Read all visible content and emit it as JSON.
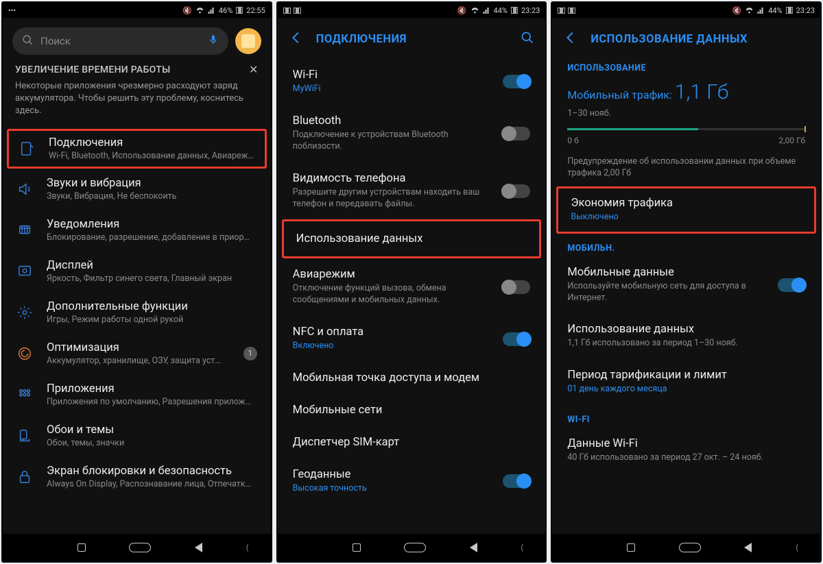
{
  "screen1": {
    "status": {
      "left_icons": "•••",
      "battery": "46%",
      "time": "22:55"
    },
    "search_placeholder": "Поиск",
    "banner": {
      "title": "УВЕЛИЧЕНИЕ ВРЕМЕНИ РАБОТЫ",
      "body": "Некоторые приложения чрезмерно расходуют заряд аккумулятора. Чтобы решить эту проблему, коснитесь здесь."
    },
    "items": [
      {
        "title": "Подключения",
        "sub": "Wi-Fi, Bluetooth, Использование данных, Авиареж…",
        "highlight": true
      },
      {
        "title": "Звуки и вибрация",
        "sub": "Звуки, Вибрация, Не беспокоить"
      },
      {
        "title": "Уведомления",
        "sub": "Блокирование, разрешение, добавление в приор…"
      },
      {
        "title": "Дисплей",
        "sub": "Яркость, Фильтр синего света, Главный экран"
      },
      {
        "title": "Дополнительные функции",
        "sub": "Игры, Режим работы одной рукой"
      },
      {
        "title": "Оптимизация",
        "sub": "Аккумулятор, хранилище, ОЗУ, защита уст…",
        "badge": "1"
      },
      {
        "title": "Приложения",
        "sub": "Приложения по умолчанию, Разрешения прилож…"
      },
      {
        "title": "Обои и темы",
        "sub": "Обои, темы, значки"
      },
      {
        "title": "Экран блокировки и безопасность",
        "sub": "Always On Display, Распознавание лица, Отпечатк…"
      }
    ]
  },
  "screen2": {
    "status": {
      "battery": "44%",
      "time": "23:23"
    },
    "title": "ПОДКЛЮЧЕНИЯ",
    "items": [
      {
        "title": "Wi-Fi",
        "sub": "MyWiFi",
        "blue": true,
        "toggle": "on"
      },
      {
        "title": "Bluetooth",
        "sub": "Подключение к устройствам Bluetooth поблизости.",
        "toggle": "off"
      },
      {
        "title": "Видимость телефона",
        "sub": "Разрешите другим устройствам находить ваш телефон и передавать файлы.",
        "toggle": "off"
      },
      {
        "title": "Использование данных",
        "highlight": true
      },
      {
        "title": "Авиарежим",
        "sub": "Отключение функций вызова, обмена сообщениями и мобильных данных.",
        "toggle": "off"
      },
      {
        "title": "NFC и оплата",
        "sub": "Включено",
        "blue": true,
        "toggle": "on"
      },
      {
        "title": "Мобильная точка доступа и модем"
      },
      {
        "title": "Мобильные сети"
      },
      {
        "title": "Диспетчер SIM-карт"
      },
      {
        "title": "Геоданные",
        "sub": "Высокая точность",
        "blue": true,
        "toggle": "on"
      }
    ]
  },
  "screen3": {
    "status": {
      "battery": "44%",
      "time": "23:23"
    },
    "title": "ИСПОЛЬЗОВАНИЕ ДАННЫХ",
    "section_usage": "ИСПОЛЬЗОВАНИЕ",
    "usage": {
      "label": "Мобильный трафик:",
      "value": "1,1 Гб",
      "period": "1–30 нояб.",
      "scale_left": "0 б",
      "scale_right": "2,00 Гб",
      "fill_pct": 55,
      "marker_pct": 100,
      "warning": "Предупреждение об использовании данных при объеме трафика 2,00 Гб"
    },
    "saver": {
      "title": "Экономия трафика",
      "sub": "Выключено"
    },
    "section_mobile": "МОБИЛЬН.",
    "mobile_items": [
      {
        "title": "Мобильные данные",
        "sub": "Используйте мобильную сеть для доступа в Интернет.",
        "toggle": "on"
      },
      {
        "title": "Использование данных",
        "sub": "1,1 Гб использовано за период 1–30 нояб."
      },
      {
        "title": "Период тарификации и лимит",
        "sub": "01 день каждого месяца",
        "blue": true
      }
    ],
    "section_wifi": "WI-FI",
    "wifi_items": [
      {
        "title": "Данные Wi-Fi",
        "sub": "40 Гб использовано за период 27 окт. – 24 нояб."
      }
    ]
  }
}
